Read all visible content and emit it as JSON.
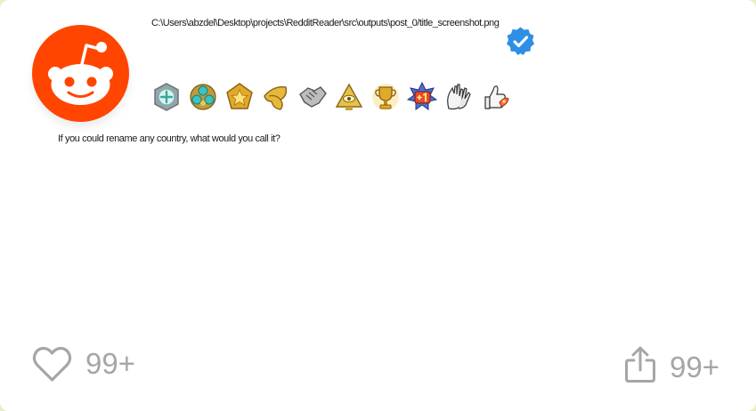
{
  "post": {
    "username": "C:\\Users\\abzdel\\Desktop\\projects\\RedditReader\\src\\outputs\\post_0/title_screenshot.png",
    "title": "If you could rename any country, what would you call it?",
    "avatar_icon": "reddit-snoo-icon",
    "verified_icon": "verified-badge-icon"
  },
  "awards": [
    {
      "icon": "silver-award-icon"
    },
    {
      "icon": "gold-cluster-award-icon"
    },
    {
      "icon": "gold-star-award-icon"
    },
    {
      "icon": "golden-leaf-award-icon"
    },
    {
      "icon": "handshake-award-icon"
    },
    {
      "icon": "all-seeing-eye-award-icon"
    },
    {
      "icon": "trophy-award-icon"
    },
    {
      "icon": "plus-one-award-icon"
    },
    {
      "icon": "clapping-hands-award-icon"
    },
    {
      "icon": "thumbs-up-rocket-award-icon"
    }
  ],
  "footer": {
    "like_count": "99+",
    "share_count": "99+",
    "like_icon": "heart-icon",
    "share_icon": "share-icon"
  },
  "colors": {
    "reddit_orange": "#ff4500",
    "verified_blue": "#2e8fe6",
    "muted_gray": "#a6a6a6"
  }
}
